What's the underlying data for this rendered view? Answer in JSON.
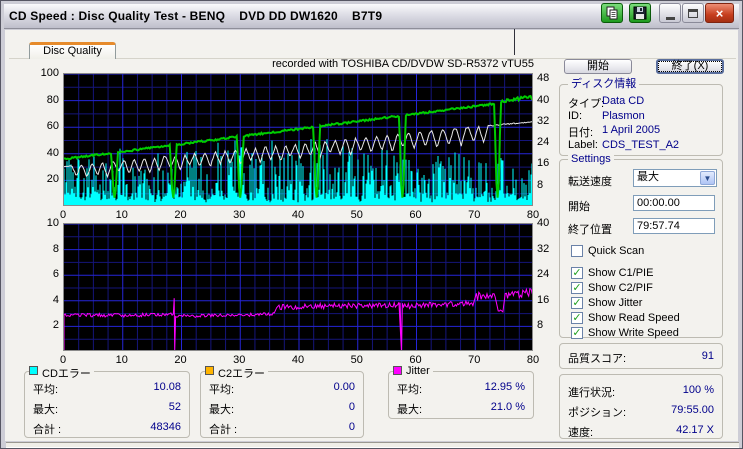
{
  "window": {
    "title": "CD Speed : Disc Quality Test - BENQ    DVD DD DW1620    B7T9",
    "controls": {
      "copy_icon": "copy-pages",
      "save_icon": "floppy-disk",
      "minimize": "minimize",
      "maximize": "maximize",
      "close": "×"
    }
  },
  "tab": {
    "label": "Disc Quality"
  },
  "buttons": {
    "start": "開始",
    "exit": "終了(X)"
  },
  "disc_info": {
    "title": "ディスク情報",
    "rows": [
      {
        "label": "タイプ:",
        "value": "Data CD"
      },
      {
        "label": "ID:",
        "value": "Plasmon"
      },
      {
        "label": "日付:",
        "value": "1 April 2005"
      },
      {
        "label": "Label:",
        "value": "CDS_TEST_A2"
      }
    ]
  },
  "settings": {
    "title": "Settings",
    "speed_label": "転送速度",
    "speed_value": "最大",
    "start_label": "開始",
    "start_value": "00:00.00",
    "end_label": "終了位置",
    "end_value": "79:57.74",
    "checkboxes": [
      {
        "label": "Quick Scan",
        "checked": false
      },
      {
        "label": "Show C1/PIE",
        "checked": true
      },
      {
        "label": "Show C2/PIF",
        "checked": true
      },
      {
        "label": "Show Jitter",
        "checked": true
      },
      {
        "label": "Show Read Speed",
        "checked": true
      },
      {
        "label": "Show Write Speed",
        "checked": true
      }
    ]
  },
  "quality": {
    "label": "品質スコア:",
    "value": "91"
  },
  "progress": {
    "rows": [
      {
        "label": "進行状況:",
        "value": "100 %"
      },
      {
        "label": "ポジション:",
        "value": "79:55.00"
      },
      {
        "label": "速度:",
        "value": "42.17 X"
      }
    ]
  },
  "stats": [
    {
      "name": "CDエラー",
      "color": "#00FFFF",
      "rows": [
        {
          "label": "平均:",
          "value": "10.08"
        },
        {
          "label": "最大:",
          "value": "52"
        },
        {
          "label": "合計 :",
          "value": "48346"
        }
      ]
    },
    {
      "name": "C2エラー",
      "color": "#FFB400",
      "rows": [
        {
          "label": "平均:",
          "value": "0.00"
        },
        {
          "label": "最大:",
          "value": "0"
        },
        {
          "label": "合計 :",
          "value": "0"
        }
      ]
    },
    {
      "name": "Jitter",
      "color": "#FF00FF",
      "rows": [
        {
          "label": "平均:",
          "value": "12.95 %"
        },
        {
          "label": "最大:",
          "value": "21.0 %"
        }
      ]
    }
  ],
  "chart_data": [
    {
      "type": "line",
      "title": "recorded with TOSHIBA CD/DVDW SD-R5372 vTU55",
      "x_range": [
        0,
        80
      ],
      "left_range": [
        0,
        100
      ],
      "right_range": [
        0,
        50
      ],
      "x_ticks": [
        0,
        10,
        20,
        30,
        40,
        50,
        60,
        70,
        80
      ],
      "left_ticks": [
        100,
        80,
        60,
        40,
        20
      ],
      "right_ticks": [
        48,
        40,
        32,
        24,
        16,
        8
      ],
      "grid": {
        "x_minor": 2.5,
        "x_major": 10,
        "y_minor": 10,
        "y_major": 20
      },
      "series": [
        {
          "name": "C1 errors",
          "type": "spikes",
          "color": "#00FFFF",
          "avg": 10.08,
          "max": 52,
          "base": 3
        },
        {
          "name": "write speed",
          "type": "dipped-line",
          "color": "#E8E8E8",
          "width": 1,
          "start": 30.5,
          "end": 64.3,
          "noise": 0.5,
          "dip_width": 0.8,
          "dips": [
            [
              2.1,
              8
            ],
            [
              3.9,
              10
            ],
            [
              5.7,
              9
            ],
            [
              7.4,
              11
            ],
            [
              9.3,
              8
            ],
            [
              11.1,
              10
            ],
            [
              12.8,
              9
            ],
            [
              14.6,
              11
            ],
            [
              16.2,
              10
            ],
            [
              18.1,
              9
            ],
            [
              19.8,
              11
            ],
            [
              21.4,
              8
            ],
            [
              23.1,
              10
            ],
            [
              24.9,
              11
            ],
            [
              26.6,
              9
            ],
            [
              28.3,
              10
            ],
            [
              30.1,
              12
            ],
            [
              31.8,
              9
            ],
            [
              33.4,
              11
            ],
            [
              35.2,
              10
            ],
            [
              36.9,
              12
            ],
            [
              38.5,
              9
            ],
            [
              40.2,
              11
            ],
            [
              41.9,
              10
            ],
            [
              43.6,
              12
            ],
            [
              45.3,
              9
            ],
            [
              47.0,
              11
            ],
            [
              48.8,
              12
            ],
            [
              50.5,
              10
            ],
            [
              52.3,
              12
            ],
            [
              54.1,
              11
            ],
            [
              55.9,
              13
            ],
            [
              57.7,
              10
            ],
            [
              59.6,
              12
            ],
            [
              61.5,
              11
            ],
            [
              63.5,
              13
            ],
            [
              65.5,
              12
            ],
            [
              67.6,
              13
            ],
            [
              69.7,
              11
            ],
            [
              71.4,
              12
            ]
          ]
        },
        {
          "name": "read speed",
          "type": "floor-dip-line",
          "color": "#00CC00",
          "width": 2,
          "start": 36,
          "end": 81.5,
          "noise": 0.7,
          "dip_width": 0.5,
          "dip_floor": 7,
          "dips": [
            8.6,
            18.6,
            30.0,
            43.0,
            57.6,
            73.8
          ],
          "late": {
            "from": 74,
            "boost": 1.4,
            "noise": 1.3
          },
          "end_speed_x": 42.17
        }
      ]
    },
    {
      "type": "line",
      "title": "",
      "x_range": [
        0,
        80
      ],
      "left_range": [
        0,
        10
      ],
      "right_range": [
        0,
        40
      ],
      "x_ticks": [
        0,
        10,
        20,
        30,
        40,
        50,
        60,
        70,
        80
      ],
      "left_ticks": [
        10,
        8,
        6,
        4,
        2
      ],
      "right_ticks": [
        40,
        32,
        24,
        16,
        8
      ],
      "grid": {
        "x_minor": 2.5,
        "x_major": 10,
        "y_minor": 1,
        "y_major": 2
      },
      "series": [
        {
          "name": "Jitter",
          "type": "segmented-line",
          "color": "#FF00FF",
          "width": 1,
          "avg_pct": 12.95,
          "max_pct": 21.0,
          "segments": [
            {
              "x0": 0.0,
              "x1": 18.7,
              "v0": 2.85,
              "v1": 2.9,
              "noise": 0.15
            },
            {
              "x0": 19.0,
              "x1": 36.0,
              "v0": 2.8,
              "v1": 2.95,
              "noise": 0.13
            },
            {
              "x0": 36.2,
              "x1": 57.3,
              "v0": 3.5,
              "v1": 3.7,
              "noise": 0.22
            },
            {
              "x0": 57.6,
              "x1": 70.0,
              "v0": 3.6,
              "v1": 3.8,
              "noise": 0.22
            },
            {
              "x0": 70.2,
              "x1": 73.6,
              "v0": 4.3,
              "v1": 4.5,
              "noise": 0.35
            },
            {
              "x0": 73.9,
              "x1": 74.9,
              "v0": 3.2,
              "v1": 3.2,
              "noise": 0.1
            },
            {
              "x0": 75.1,
              "x1": 80.0,
              "v0": 4.3,
              "v1": 4.7,
              "noise": 0.33
            }
          ],
          "drops": [
            {
              "x": 18.85,
              "peak": 4.2
            },
            {
              "x": 57.45,
              "peak": null
            }
          ]
        }
      ]
    }
  ],
  "colors": {
    "plot_bg": "#000000",
    "grid_major": "#2525D8",
    "grid_minor": "#15157A",
    "c1": "#00FFFF",
    "c2": "#FFB400",
    "jitter": "#FF00FF",
    "read": "#00CC00",
    "write": "#E8E8E8",
    "value_text": "#00008B",
    "tab_accent": "#E68B2C"
  },
  "seed": 20050401
}
